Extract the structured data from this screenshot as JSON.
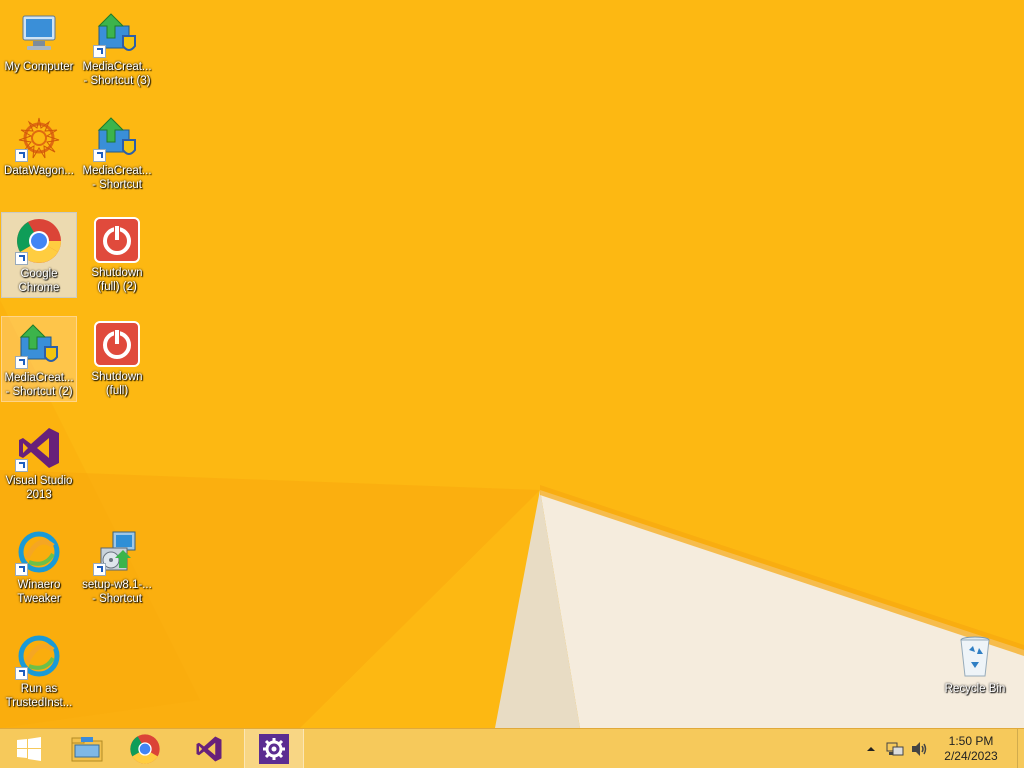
{
  "desktop_icons": [
    {
      "label": "My Computer",
      "icon": "computer-icon"
    },
    {
      "label": "MediaCreat...\n- Shortcut (3)",
      "icon": "media-creation-icon"
    },
    {
      "label": "DataWagon...",
      "icon": "datawagon-icon"
    },
    {
      "label": "MediaCreat...\n- Shortcut",
      "icon": "media-creation-icon"
    },
    {
      "label": "Google\nChrome",
      "icon": "chrome-icon"
    },
    {
      "label": "Shutdown\n(full) (2)",
      "icon": "shutdown-icon"
    },
    {
      "label": "MediaCreat...\n- Shortcut (2)",
      "icon": "media-creation-icon"
    },
    {
      "label": "Shutdown\n(full)",
      "icon": "shutdown-icon"
    },
    {
      "label": "Visual Studio\n2013",
      "icon": "visual-studio-icon"
    },
    {
      "label": "Winaero\nTweaker",
      "icon": "winaero-tweaker-icon"
    },
    {
      "label": "setup-w8.1-...\n- Shortcut",
      "icon": "setup-installer-icon"
    },
    {
      "label": "Run as\nTrustedInst...",
      "icon": "winaero-tweaker-icon"
    },
    {
      "label": "Recycle Bin",
      "icon": "recycle-bin-icon"
    }
  ],
  "taskbar": {
    "pinned": [
      "windows-start-icon",
      "file-explorer-icon",
      "chrome-icon",
      "visual-studio-icon",
      "settings-gear-icon"
    ],
    "tray_icons": [
      "show-hidden-icons-arrow",
      "network-icon",
      "volume-icon"
    ]
  },
  "clock": {
    "time": "1:50 PM",
    "date": "2/24/2023"
  },
  "colors": {
    "wallpaper": "#fdb90f",
    "taskbar": "#f6c95b",
    "accent_purple": "#68217a"
  }
}
